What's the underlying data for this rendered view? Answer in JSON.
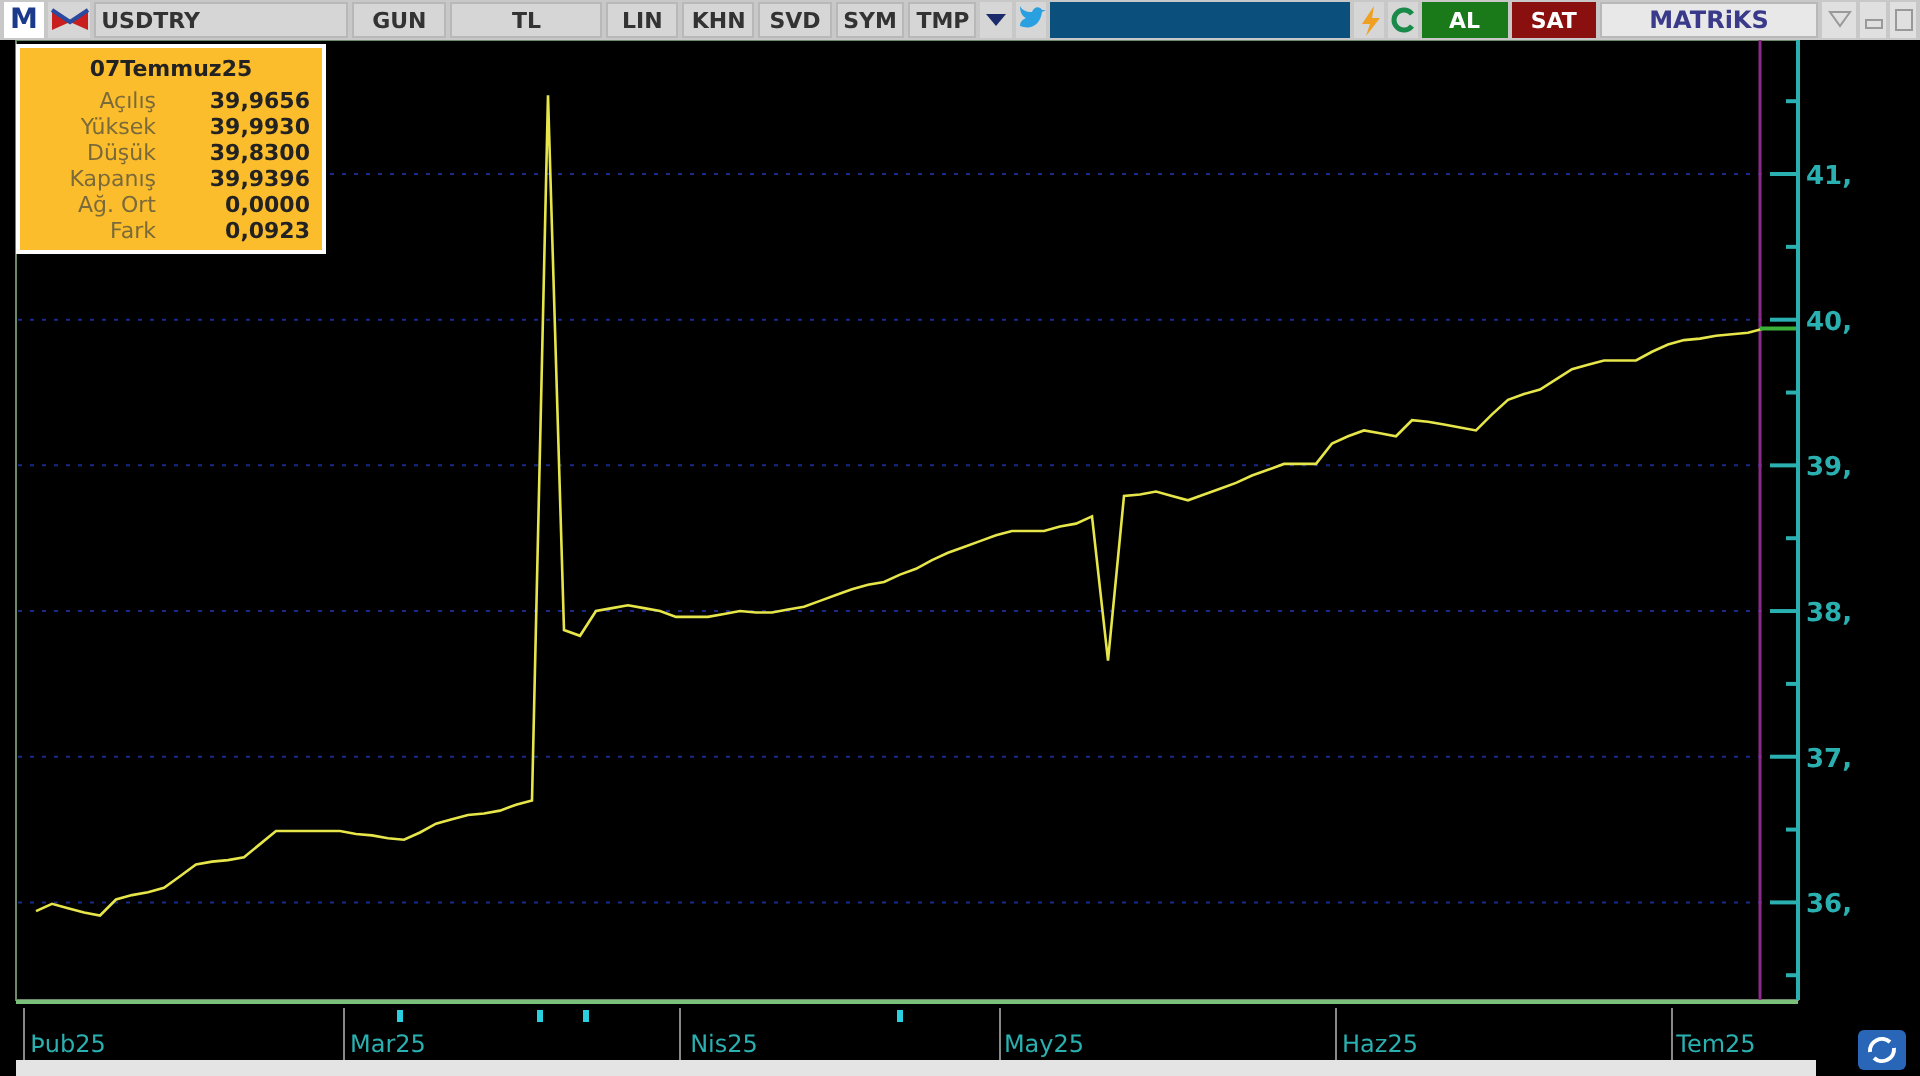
{
  "toolbar": {
    "logo": "M",
    "symbol": "USDTRY",
    "buttons": [
      "GUN",
      "TL",
      "LIN",
      "KHN",
      "SVD",
      "SYM",
      "TMP"
    ],
    "buy": "AL",
    "sell": "SAT",
    "brand": "MATRiKS"
  },
  "info_box": {
    "date": "07Temmuz25",
    "rows": [
      {
        "label": "Açılış",
        "value": "39,9656"
      },
      {
        "label": "Yüksek",
        "value": "39,9930"
      },
      {
        "label": "Düşük",
        "value": "39,8300"
      },
      {
        "label": "Kapanış",
        "value": "39,9396"
      },
      {
        "label": "Ağ. Ort",
        "value": "0,0000"
      },
      {
        "label": "Fark",
        "value": "0,0923"
      }
    ]
  },
  "chart": {
    "chart_data": {
      "type": "line",
      "grid": true,
      "ylim": [
        35.33,
        41.92
      ],
      "categories": [
        null,
        null,
        "Þub25",
        null,
        null,
        null,
        null,
        null,
        null,
        null,
        null,
        null,
        null,
        null,
        null,
        null,
        null,
        null,
        null,
        null,
        null,
        null,
        "Mar25",
        null,
        null,
        null,
        null,
        null,
        null,
        null,
        null,
        null,
        null,
        null,
        null,
        null,
        null,
        null,
        null,
        null,
        null,
        null,
        null,
        "Nis25",
        null,
        null,
        null,
        null,
        null,
        null,
        null,
        null,
        null,
        null,
        null,
        null,
        null,
        null,
        null,
        null,
        null,
        null,
        null,
        "May25",
        null,
        null,
        null,
        null,
        null,
        null,
        null,
        null,
        null,
        null,
        null,
        null,
        null,
        null,
        null,
        null,
        null,
        null,
        null,
        null,
        "Haz25",
        null,
        null,
        null,
        null,
        null,
        null,
        null,
        null,
        null,
        null,
        null,
        null,
        null,
        null,
        null,
        null,
        null,
        null,
        null,
        null,
        "Tem25",
        null,
        null,
        null
      ],
      "series": [
        {
          "color": "#e6e64a",
          "values": [
            35.94,
            35.99,
            35.96,
            35.93,
            35.91,
            36.02,
            36.05,
            36.07,
            36.1,
            36.18,
            36.26,
            36.28,
            36.29,
            36.31,
            36.4,
            36.49,
            36.49,
            36.49,
            36.49,
            36.49,
            36.47,
            36.46,
            36.44,
            36.43,
            36.48,
            36.54,
            36.57,
            36.6,
            36.61,
            36.63,
            36.67,
            36.7,
            41.54,
            37.87,
            37.83,
            38.0,
            38.02,
            38.04,
            38.02,
            38.0,
            37.96,
            37.96,
            37.96,
            37.98,
            38.0,
            37.99,
            37.99,
            38.01,
            38.03,
            38.07,
            38.11,
            38.15,
            38.18,
            38.2,
            38.25,
            38.29,
            38.35,
            38.4,
            38.44,
            38.48,
            38.52,
            38.55,
            38.55,
            38.55,
            38.58,
            38.6,
            38.65,
            37.66,
            38.79,
            38.8,
            38.82,
            38.79,
            38.76,
            38.8,
            38.84,
            38.88,
            38.93,
            38.97,
            39.01,
            39.01,
            39.01,
            39.15,
            39.2,
            39.24,
            39.22,
            39.2,
            39.31,
            39.3,
            39.28,
            39.26,
            39.24,
            39.35,
            39.45,
            39.49,
            39.52,
            39.59,
            39.66,
            39.69,
            39.72,
            39.72,
            39.72,
            39.78,
            39.83,
            39.86,
            39.87,
            39.89,
            39.9,
            39.91,
            39.94
          ]
        }
      ],
      "yticks": [
        {
          "value": 36,
          "label": "36,"
        },
        {
          "value": 37,
          "label": "37,"
        },
        {
          "value": 38,
          "label": "38,"
        },
        {
          "value": 39,
          "label": "39,"
        },
        {
          "value": 40,
          "label": "40,"
        },
        {
          "value": 41,
          "label": "41,"
        }
      ]
    }
  }
}
